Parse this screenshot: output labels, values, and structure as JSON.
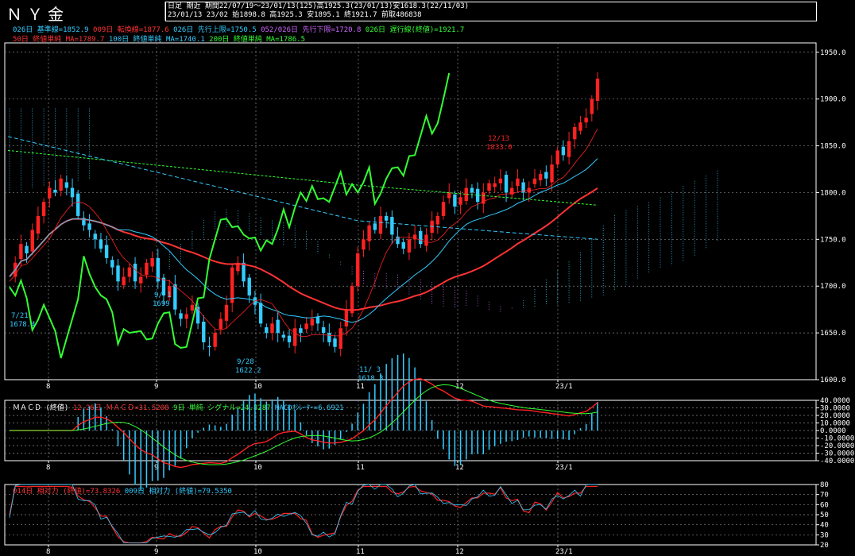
{
  "header": {
    "title": "ＮＹ金",
    "freq": "日足",
    "contract": "期近",
    "period_info": "期間22/07/19～23/01/13(125)高1925.3(23/01/13)安1618.3(22/11/03)",
    "last_bar_info": "23/01/13 23/02 始1898.8 高1925.3 安1895.1 終1921.7 前取486838"
  },
  "legend": {
    "ichimoku": [
      {
        "text": "026日 基準線=1852.9",
        "color": "#33ccff"
      },
      {
        "text": "009日 転換線=1877.6",
        "color": "#ff3333"
      },
      {
        "text": "026日 先行上限=1750.5",
        "color": "#33ccff"
      },
      {
        "text": "052/026日 先行下限=1720.8",
        "color": "#cc66ff"
      },
      {
        "text": "026日 遅行線(終値)=1921.7",
        "color": "#33ff33"
      }
    ],
    "ma": [
      {
        "text": "50日 終値単純 MA=1789.7",
        "color": "#ff3333"
      },
      {
        "text": "100日 終値単純 MA=1740.1",
        "color": "#33ccff"
      },
      {
        "text": "200日 終値単純 MA=1786.5",
        "color": "#33ff33"
      }
    ]
  },
  "macd_legend": {
    "label": "ＭＡＣＤ (終値)",
    "macd": "12-26日 ＭＡＣＤ=31.5208",
    "signal": "9日 単純 シグナル=24.8287",
    "osc": "MACDｵｼﾚｰﾀｰ=6.6921"
  },
  "rsi_legend": {
    "rsi14": "014日 相対力 (終値)=73.8326",
    "rsi9": "009日 相対力 (終値)=79.5350"
  },
  "annotations": [
    {
      "text": "7/21",
      "sub": "1678.4"
    },
    {
      "text": "9/28",
      "sub": "1622.2"
    },
    {
      "text": "11/ 3",
      "sub": "1618.3"
    },
    {
      "text": "12/13",
      "sub": "1833.0"
    },
    {
      "text": "9/ 1",
      "sub": "1699"
    }
  ],
  "x_ticks": [
    "8",
    "9",
    "10",
    "11",
    "12",
    "23/1"
  ],
  "colors": {
    "up": "#ff2222",
    "down": "#33ccff",
    "ma50": "#ff3333",
    "ma100": "#33ccff",
    "ma200": "#33ff33",
    "lagging": "#33ff33",
    "cloud_a": "#cc66ff",
    "cloud_b": "#33ccff",
    "grid": "#888888"
  },
  "chart_data": [
    {
      "type": "candlestick",
      "title": "ＮＹ金",
      "ylim": [
        1600,
        1960
      ],
      "y_ticks": [
        1600,
        1650,
        1700,
        1750,
        1800,
        1850,
        1900,
        1950
      ],
      "x_ticks": [
        "8",
        "9",
        "10",
        "11",
        "12",
        "23/1"
      ],
      "close_path": [
        1710,
        1725,
        1745,
        1735,
        1760,
        1775,
        1790,
        1805,
        1800,
        1815,
        1805,
        1795,
        1775,
        1765,
        1760,
        1750,
        1740,
        1730,
        1720,
        1705,
        1710,
        1720,
        1705,
        1710,
        1725,
        1730,
        1705,
        1690,
        1700,
        1675,
        1665,
        1670,
        1680,
        1660,
        1640,
        1635,
        1650,
        1665,
        1680,
        1720,
        1725,
        1705,
        1690,
        1680,
        1660,
        1650,
        1660,
        1650,
        1645,
        1640,
        1655,
        1650,
        1660,
        1665,
        1660,
        1650,
        1640,
        1635,
        1655,
        1675,
        1700,
        1735,
        1750,
        1765,
        1760,
        1775,
        1770,
        1755,
        1745,
        1740,
        1750,
        1755,
        1745,
        1755,
        1770,
        1775,
        1790,
        1800,
        1785,
        1795,
        1805,
        1800,
        1790,
        1800,
        1810,
        1810,
        1815,
        1800,
        1805,
        1815,
        1800,
        1805,
        1815,
        1820,
        1815,
        1830,
        1845,
        1840,
        1855,
        1870,
        1875,
        1880,
        1900,
        1921.7
      ],
      "ma50_endpoint": 1789.7,
      "ma100_endpoint": 1740.1,
      "ma200_endpoint": 1786.5
    },
    {
      "type": "line",
      "title": "ＭＡＣＤ (終値)",
      "ylim": [
        -40,
        40
      ],
      "y_ticks": [
        40,
        30,
        20,
        10,
        0,
        -10,
        -20,
        -30,
        -40
      ],
      "series": [
        {
          "name": "12-26日 ＭＡＣＤ",
          "last": 31.5208
        },
        {
          "name": "9日 単純 シグナル",
          "last": 24.8287
        },
        {
          "name": "MACDｵｼﾚｰﾀｰ",
          "last": 6.6921
        }
      ]
    },
    {
      "type": "line",
      "title": "相対力",
      "ylim": [
        20,
        80
      ],
      "y_ticks": [
        80,
        70,
        60,
        50,
        40,
        30,
        20
      ],
      "series": [
        {
          "name": "014日 相対力 (終値)",
          "last": 73.8326
        },
        {
          "name": "009日 相対力 (終値)",
          "last": 79.535
        }
      ]
    }
  ]
}
